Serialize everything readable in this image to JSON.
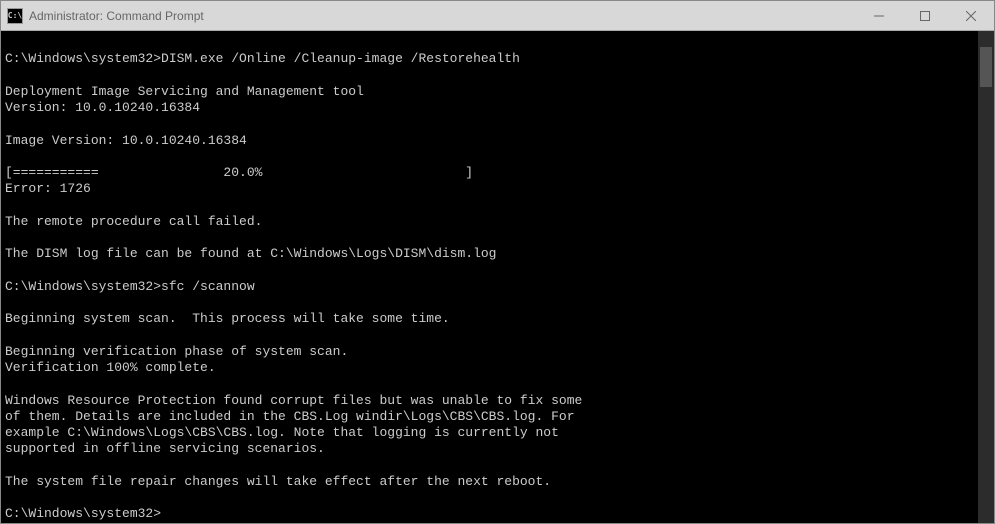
{
  "window": {
    "icon_text": "C:\\",
    "title": "Administrator: Command Prompt"
  },
  "terminal": {
    "lines": [
      "",
      "C:\\Windows\\system32>DISM.exe /Online /Cleanup-image /Restorehealth",
      "",
      "Deployment Image Servicing and Management tool",
      "Version: 10.0.10240.16384",
      "",
      "Image Version: 10.0.10240.16384",
      "",
      "[===========                20.0%                          ]",
      "Error: 1726",
      "",
      "The remote procedure call failed.",
      "",
      "The DISM log file can be found at C:\\Windows\\Logs\\DISM\\dism.log",
      "",
      "C:\\Windows\\system32>sfc /scannow",
      "",
      "Beginning system scan.  This process will take some time.",
      "",
      "Beginning verification phase of system scan.",
      "Verification 100% complete.",
      "",
      "Windows Resource Protection found corrupt files but was unable to fix some",
      "of them. Details are included in the CBS.Log windir\\Logs\\CBS\\CBS.log. For",
      "example C:\\Windows\\Logs\\CBS\\CBS.log. Note that logging is currently not",
      "supported in offline servicing scenarios.",
      "",
      "The system file repair changes will take effect after the next reboot.",
      "",
      "C:\\Windows\\system32>"
    ]
  }
}
